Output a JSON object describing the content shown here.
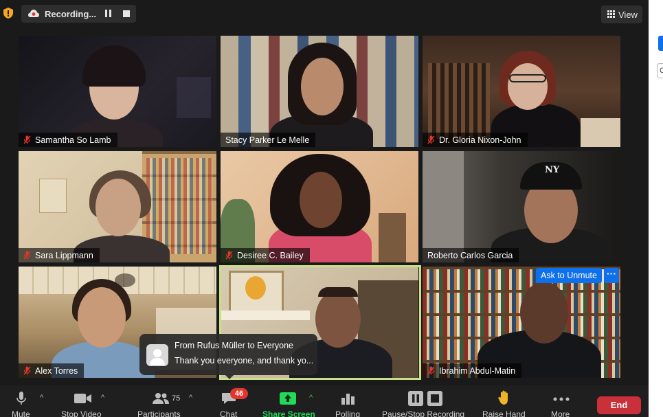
{
  "topbar": {
    "recording_label": "Recording...",
    "view_label": "View"
  },
  "tiles": [
    {
      "name": "Samantha So Lamb",
      "muted": true
    },
    {
      "name": "Stacy Parker Le Melle",
      "muted": false
    },
    {
      "name": "Dr. Gloria Nixon-John",
      "muted": true
    },
    {
      "name": "Sara Lippmann",
      "muted": true
    },
    {
      "name": "Desiree C. Bailey",
      "muted": true
    },
    {
      "name": "Roberto Carlos Garcia",
      "muted": false
    },
    {
      "name": "Alex Torres",
      "muted": true
    },
    {
      "name": "",
      "muted": false
    },
    {
      "name": "Ibrahim Abdul-Matin",
      "muted": true
    }
  ],
  "tile_actions": {
    "ask_to_unmute": "Ask to Unmute",
    "more": "···"
  },
  "chat_toast": {
    "from": "From Rufus Müller to Everyone",
    "message": "Thank you everyone, and thank yo..."
  },
  "toolbar": {
    "mute": "Mute",
    "stop_video": "Stop Video",
    "participants": "Participants",
    "participants_count": "75",
    "chat": "Chat",
    "chat_badge": "46",
    "share_screen": "Share Screen",
    "polling": "Polling",
    "pause_stop_recording": "Pause/Stop Recording",
    "raise_hand": "Raise Hand",
    "more": "More",
    "end": "End"
  },
  "colors": {
    "accent_blue": "#0e71eb",
    "share_green": "#23d959",
    "end_red": "#c9303a",
    "badge_red": "#e0362c",
    "active_speaker": "#c8e08a"
  }
}
